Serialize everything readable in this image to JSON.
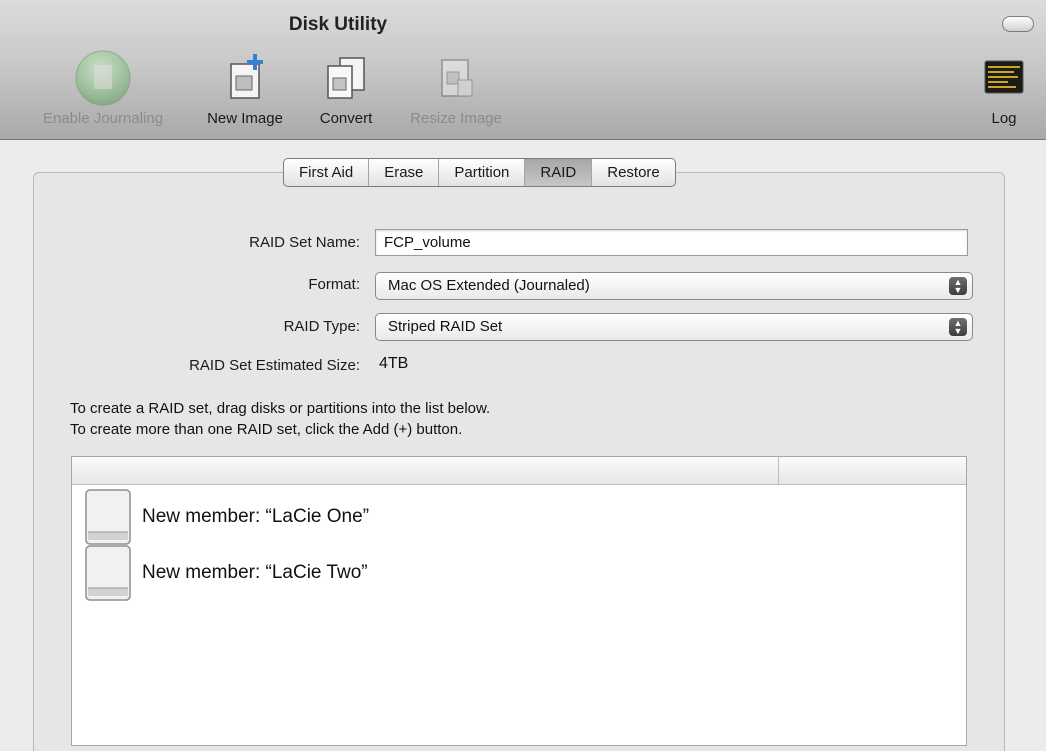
{
  "window": {
    "title": "Disk Utility"
  },
  "toolbar": {
    "items": [
      {
        "label": "Enable Journaling",
        "icon": "journaling-icon",
        "enabled": false
      },
      {
        "label": "New Image",
        "icon": "new-image-icon",
        "enabled": true
      },
      {
        "label": "Convert",
        "icon": "convert-icon",
        "enabled": true
      },
      {
        "label": "Resize Image",
        "icon": "resize-image-icon",
        "enabled": false
      },
      {
        "label": "Log",
        "icon": "log-icon",
        "enabled": true
      }
    ]
  },
  "tabs": [
    {
      "label": "First Aid",
      "active": false
    },
    {
      "label": "Erase",
      "active": false
    },
    {
      "label": "Partition",
      "active": false
    },
    {
      "label": "RAID",
      "active": true
    },
    {
      "label": "Restore",
      "active": false
    }
  ],
  "raid": {
    "set_name_label": "RAID Set Name:",
    "set_name_value": "FCP_volume",
    "format_label": "Format:",
    "format_value": "Mac OS Extended (Journaled)",
    "type_label": "RAID Type:",
    "type_value": "Striped RAID Set",
    "size_label": "RAID Set Estimated Size:",
    "size_value": "4TB",
    "instructions": [
      "To create a RAID set, drag disks or partitions into the list below.",
      "To create more than one RAID set, click the Add (+) button."
    ]
  },
  "members": [
    {
      "label": "New member: “LaCie One”"
    },
    {
      "label": "New member: “LaCie Two”"
    }
  ],
  "colors": {
    "toolbar_top": "#dcdcdc",
    "toolbar_bottom": "#a9a9a9",
    "journaling_green": "#7fc77a"
  }
}
